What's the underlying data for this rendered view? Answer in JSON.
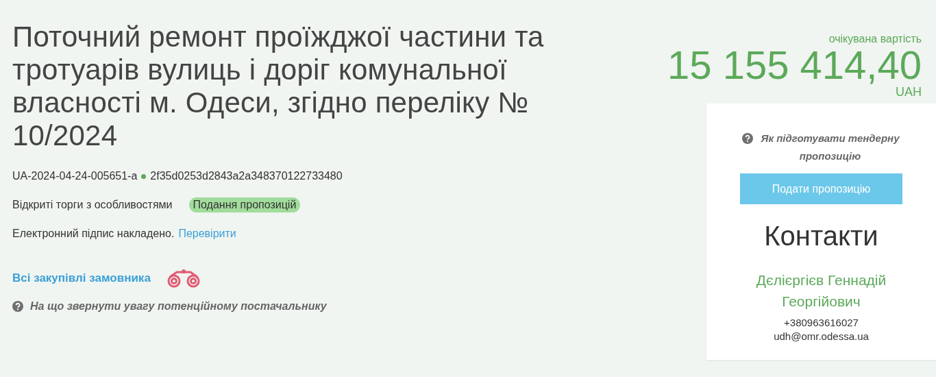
{
  "tender": {
    "title": "Поточний ремонт проїжджої частини та тротуарів вулиць і доріг комунальної власності м. Одеси, згідно переліку № 10/2024",
    "id": "UA-2024-04-24-005651-a",
    "hash": "2f35d0253d2843a2a348370122733480",
    "procedure": "Відкриті торги з особливостями",
    "status": "Подання пропозицій",
    "signature": "Електронний підпис накладено.",
    "signature_link": "Перевірити",
    "customer_link": "Всі закупівлі замовника",
    "hint": "На що звернути увагу потенційному постачальнику"
  },
  "price": {
    "label": "очікувана вартість",
    "amount": "15 155 414,40",
    "currency": "UAH"
  },
  "sidebar": {
    "help": "Як підготувати тендерну пропозицію",
    "button": "Подати пропозицію",
    "contacts_title": "Контакти",
    "contact": {
      "name": "Дєлієргієв Геннадій Георгійович",
      "phone": "+380963616027",
      "email": "udh@omr.odessa.ua"
    }
  }
}
